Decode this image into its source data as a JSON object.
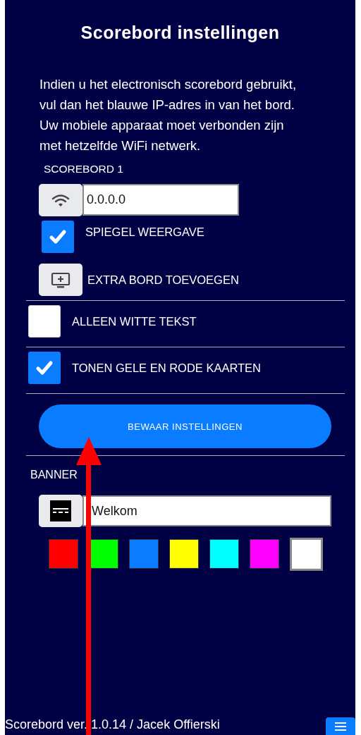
{
  "title": "Scorebord instellingen",
  "intro": "Indien u het electronisch scorebord gebruikt,\nvul dan het blauwe IP-adres in van het bord.\nUw mobiele apparaat moet verbonden zijn\nmet hetzelfde WiFi netwerk.",
  "scoreboard": {
    "label": "SCOREBORD 1",
    "ip": "0.0.0.0",
    "mirror": {
      "label": "SPIEGEL WEERGAVE",
      "checked": true
    },
    "add_board": "EXTRA BORD TOEVOEGEN"
  },
  "options": [
    {
      "label": "ALLEEN WITTE TEKST",
      "checked": false
    },
    {
      "label": "TONEN GELE EN RODE KAARTEN",
      "checked": true
    }
  ],
  "save_button": "BEWAAR INSTELLINGEN",
  "banner": {
    "label": "BANNER",
    "text": "Welkom",
    "colors": [
      {
        "color": "#ff0000",
        "selected": false
      },
      {
        "color": "#00ff00",
        "selected": false
      },
      {
        "color": "#0a7cff",
        "selected": false
      },
      {
        "color": "#ffff00",
        "selected": false
      },
      {
        "color": "#00ffff",
        "selected": false
      },
      {
        "color": "#ff00ff",
        "selected": false
      },
      {
        "color": "#ffffff",
        "selected": true
      }
    ]
  },
  "footer": "Scorebord ver. 1.0.14 / Jacek Offierski"
}
